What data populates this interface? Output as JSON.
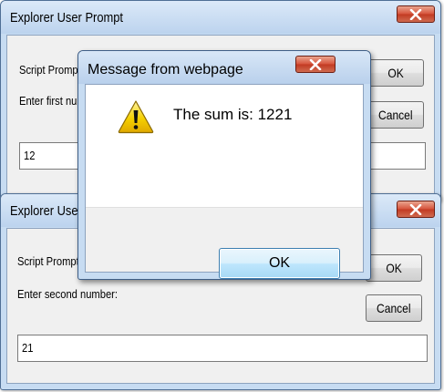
{
  "prompt_first": {
    "title": "Explorer User Prompt",
    "script_prompt_label": "Script Prompt:",
    "instruction": "Enter first num",
    "value": "12",
    "ok_label": "OK",
    "cancel_label": "Cancel"
  },
  "prompt_second": {
    "title": "Explorer User P",
    "script_prompt_label": "Script Prompt:",
    "instruction": "Enter second number:",
    "value": "21",
    "ok_label": "OK",
    "cancel_label": "Cancel"
  },
  "message_dialog": {
    "title": "Message from webpage",
    "message": "The sum is: 1221",
    "ok_label": "OK",
    "icon": "warning-icon"
  },
  "colors": {
    "frame": "#c7dcf2",
    "close_button": "#c9452e",
    "ok_focus_border": "#3c7fb1"
  }
}
